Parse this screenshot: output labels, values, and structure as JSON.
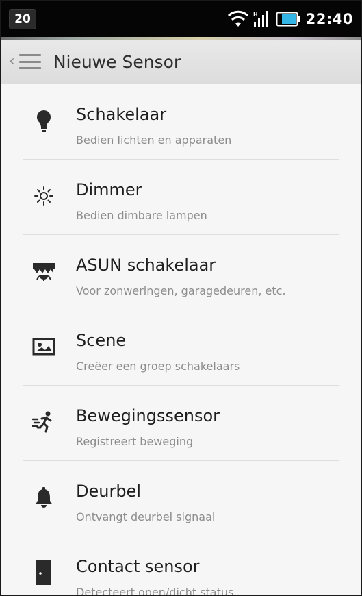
{
  "status_bar": {
    "badge": "20",
    "time": "22:40"
  },
  "action_bar": {
    "title": "Nieuwe Sensor"
  },
  "colors": {
    "status_bar_bg": "#050505",
    "action_bar_bg": "#e3e3e3",
    "list_bg": "#f6f6f6",
    "title_text": "#1e1e1e",
    "subtitle_text": "#8c8c8c",
    "icon": "#2a2a2a"
  },
  "sensor_types": [
    {
      "title": "Schakelaar",
      "subtitle": "Bedien lichten en apparaten",
      "icon": "lightbulb-icon"
    },
    {
      "title": "Dimmer",
      "subtitle": "Bedien dimbare lampen",
      "icon": "sun-icon"
    },
    {
      "title": "ASUN schakelaar",
      "subtitle": "Voor zonweringen, garagedeuren, etc.",
      "icon": "awning-icon"
    },
    {
      "title": "Scene",
      "subtitle": "Creëer een groep schakelaars",
      "icon": "picture-icon"
    },
    {
      "title": "Bewegingssensor",
      "subtitle": "Registreert beweging",
      "icon": "running-person-icon"
    },
    {
      "title": "Deurbel",
      "subtitle": "Ontvangt deurbel signaal",
      "icon": "bell-icon"
    },
    {
      "title": "Contact sensor",
      "subtitle": "Detecteert open/dicht status",
      "icon": "door-icon"
    }
  ]
}
